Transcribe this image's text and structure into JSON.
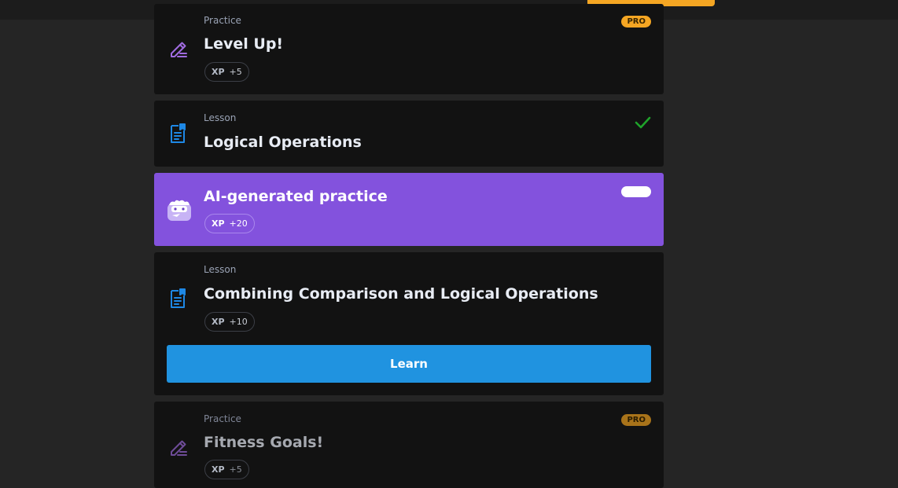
{
  "cards": [
    {
      "kind": "Practice",
      "title": "Level Up!",
      "xp_label": "XP",
      "xp_value": "+5",
      "badge": "PRO",
      "icon": "pencil-lines-icon"
    },
    {
      "kind": "Lesson",
      "title": "Logical Operations",
      "status": "completed",
      "icon": "document-icon"
    },
    {
      "title": "AI-generated practice",
      "xp_label": "XP",
      "xp_value": "+20",
      "icon": "ai-bot-icon",
      "toggle": "on"
    },
    {
      "kind": "Lesson",
      "title": "Combining Comparison and Logical Operations",
      "xp_label": "XP",
      "xp_value": "+10",
      "button_label": "Learn",
      "icon": "document-icon"
    },
    {
      "kind": "Practice",
      "title": "Fitness Goals!",
      "xp_label": "XP",
      "xp_value": "+5",
      "badge": "PRO",
      "icon": "pencil-lines-icon"
    }
  ],
  "colors": {
    "accent_orange": "#f5a623",
    "ai_purple": "#8352dd",
    "learn_blue": "#2093e0",
    "check_green": "#1fa32a",
    "lesson_icon_blue": "#1e88e5",
    "practice_icon_purple": "#a06be0"
  }
}
